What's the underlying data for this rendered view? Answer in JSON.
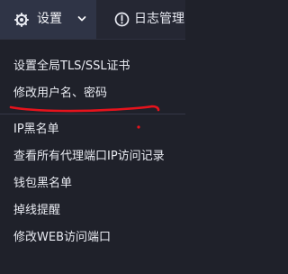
{
  "topbar": {
    "settings_label": "设置",
    "log_label": "日志管理"
  },
  "menu": {
    "items": [
      {
        "label": "设置全局TLS/SSL证书"
      },
      {
        "label": "修改用户名、密码"
      },
      {
        "label": "IP黑名单"
      },
      {
        "label": "查看所有代理端口IP访问记录"
      },
      {
        "label": "钱包黑名单"
      },
      {
        "label": "掉线提醒"
      },
      {
        "label": "修改WEB访问端口"
      }
    ]
  },
  "colors": {
    "background": "#1f212a",
    "active_tab": "#2f3446",
    "annotation": "#e6131c"
  },
  "icons": {
    "settings": "gear-icon",
    "dropdown": "chevron-down-icon",
    "log": "info-circle-icon"
  }
}
